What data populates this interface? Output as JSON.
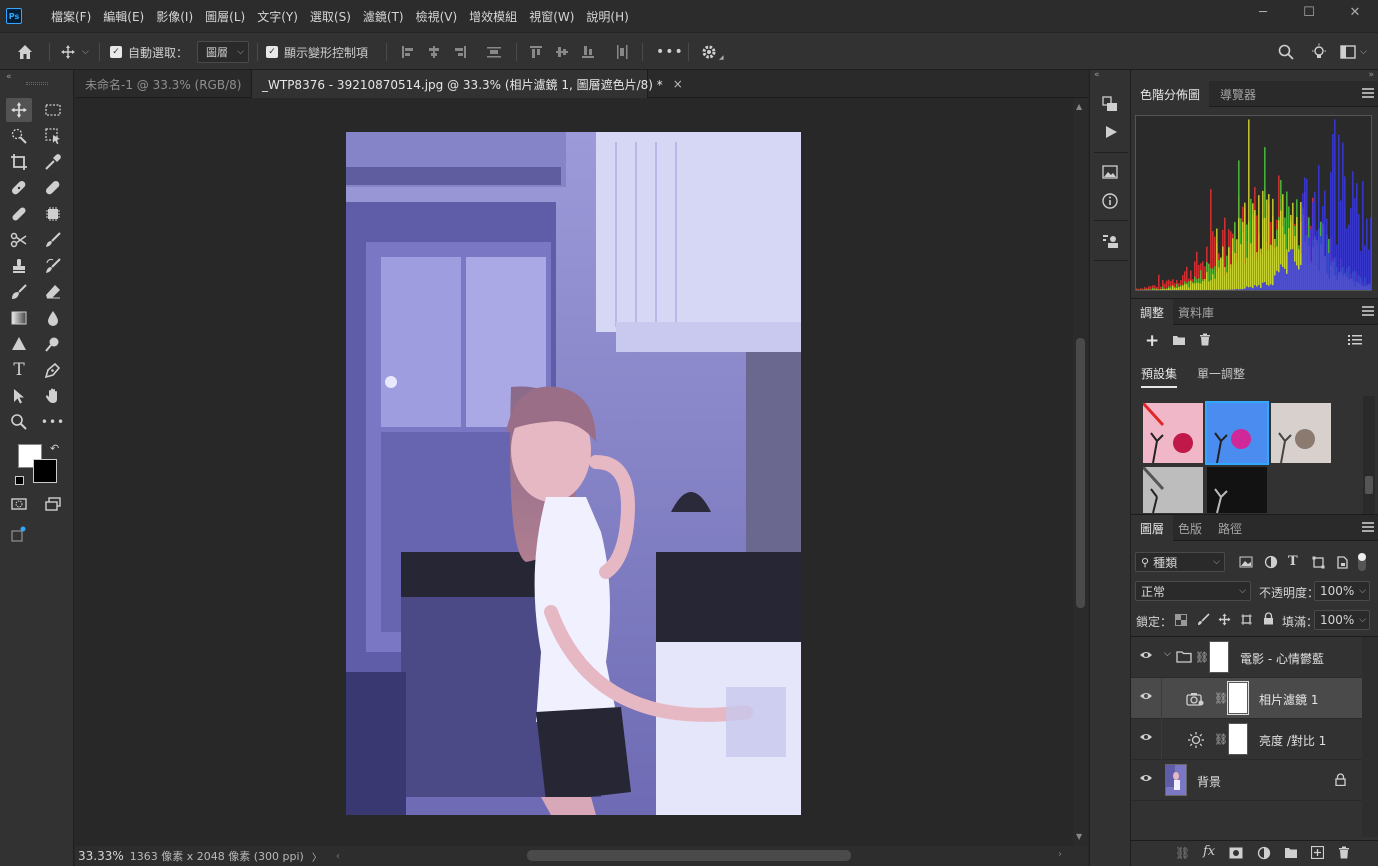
{
  "menubar": {
    "logo": "Ps",
    "items": [
      "檔案(F)",
      "編輯(E)",
      "影像(I)",
      "圖層(L)",
      "文字(Y)",
      "選取(S)",
      "濾鏡(T)",
      "檢視(V)",
      "增效模組",
      "視窗(W)",
      "說明(H)"
    ],
    "window_controls": {
      "minimize": "─",
      "maximize": "☐",
      "close": "✕"
    }
  },
  "options": {
    "auto_select_label": "自動選取：",
    "auto_select_value": "圖層",
    "show_transform_label": "顯示變形控制項",
    "more_label": "•••"
  },
  "tabs": [
    {
      "label": "未命名-1 @ 33.3% (RGB/8)",
      "close": "×",
      "active": false
    },
    {
      "label": "_WTP8376 - 39210870514.jpg @ 33.3% (相片濾鏡 1, 圖層遮色片/8) *",
      "close": "×",
      "active": true
    }
  ],
  "status": {
    "zoom": "33.33%",
    "doc_info": "1363 像素 x 2048 像素 (300 ppi)",
    "arrow": "〉"
  },
  "histogram_panel": {
    "tabs": [
      "色階分佈圖",
      "導覽器"
    ]
  },
  "adjust_panel": {
    "tabs": [
      "調整",
      "資料庫"
    ],
    "subtabs": [
      "預設集",
      "單一調整"
    ]
  },
  "layers_panel": {
    "tabs": [
      "圖層",
      "色版",
      "路徑"
    ],
    "filter_value": "種類",
    "blend_mode": "正常",
    "opacity_label": "不透明度：",
    "opacity_value": "100%",
    "lock_label": "鎖定：",
    "fill_label": "填滿：",
    "fill_value": "100%",
    "layers": [
      {
        "name": "電影 - 心情鬱藍",
        "type": "group"
      },
      {
        "name": "相片濾鏡 1",
        "type": "adjustment-photo-filter",
        "selected": true
      },
      {
        "name": "亮度 /對比 1",
        "type": "adjustment-brightness"
      },
      {
        "name": "背景",
        "type": "background",
        "locked": true
      }
    ]
  },
  "colors": {
    "accent": "#31a8ff",
    "selected_row": "#4a4a4a",
    "panel_bg": "#323232"
  }
}
